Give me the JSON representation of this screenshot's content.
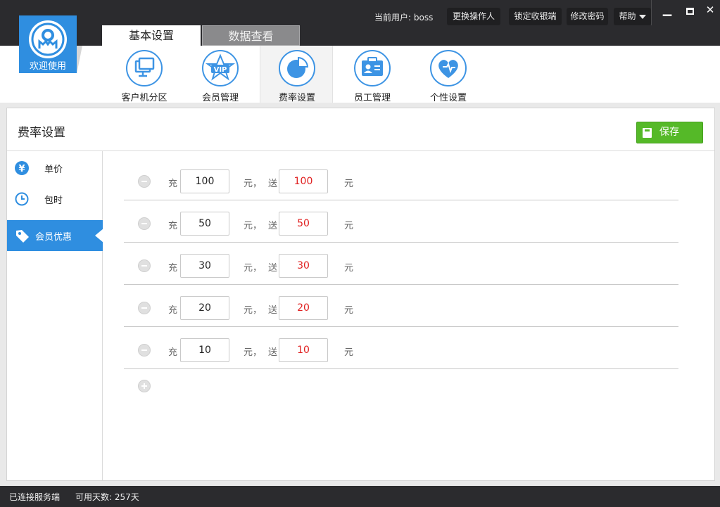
{
  "app": {
    "logo_label": "欢迎使用",
    "current_user": "当前用户: boss",
    "buttons": {
      "switch_operator": "更换操作人",
      "lock_register": "锁定收银端",
      "change_password": "修改密码",
      "help": "帮助"
    }
  },
  "tabs": [
    {
      "label": "基本设置",
      "active": true
    },
    {
      "label": "数据查看",
      "active": false
    }
  ],
  "toolbar": [
    {
      "label": "客户机分区",
      "icon": "monitor-icon"
    },
    {
      "label": "会员管理",
      "icon": "vip-icon"
    },
    {
      "label": "费率设置",
      "icon": "pie-chart-icon",
      "active": true
    },
    {
      "label": "员工管理",
      "icon": "id-card-icon"
    },
    {
      "label": "个性设置",
      "icon": "heart-icon"
    }
  ],
  "panel": {
    "title": "费率设置",
    "save_label": "保存"
  },
  "sidenav": [
    {
      "label": "单价",
      "icon": "yuan-icon"
    },
    {
      "label": "包时",
      "icon": "clock-icon"
    },
    {
      "label": "会员优惠",
      "icon": "tag-icon",
      "active": true
    }
  ],
  "labels": {
    "charge": "充",
    "yuan_comma": "元，",
    "give": "送",
    "yuan": "元"
  },
  "rows": [
    {
      "charge": "100",
      "gift": "100"
    },
    {
      "charge": "50",
      "gift": "50"
    },
    {
      "charge": "30",
      "gift": "30"
    },
    {
      "charge": "20",
      "gift": "20"
    },
    {
      "charge": "10",
      "gift": "10"
    }
  ],
  "status": {
    "connection": "已连接服务端",
    "days": "可用天数: 257天"
  },
  "colors": {
    "accent": "#2f8ee0",
    "save": "#55b928",
    "gift_value": "#e02020",
    "dark": "#2b2b2e"
  }
}
